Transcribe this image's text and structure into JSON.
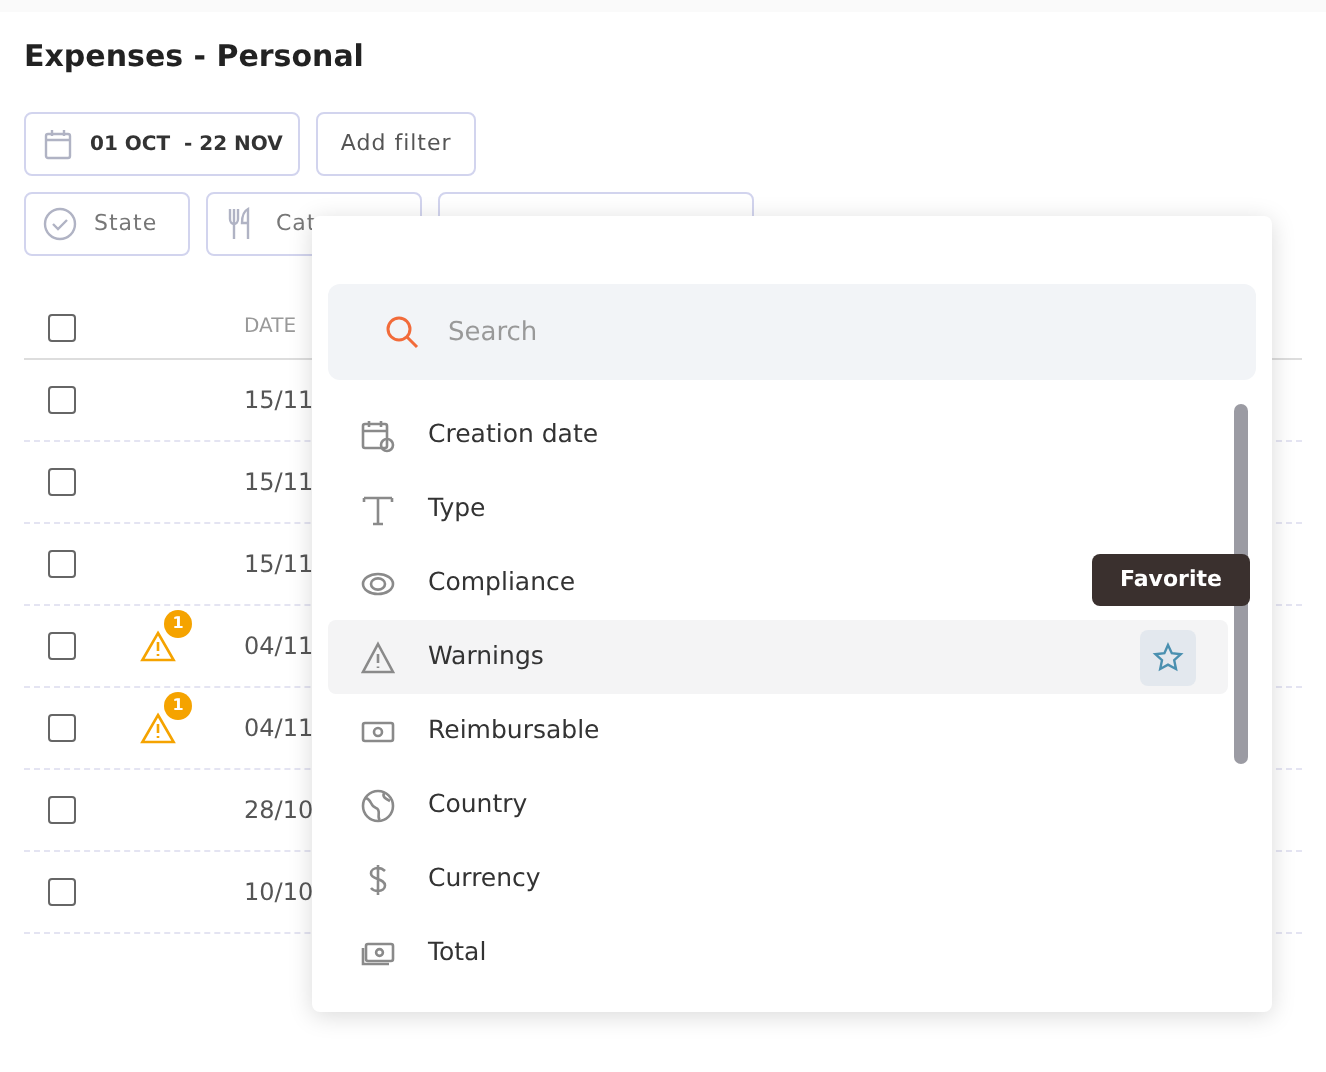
{
  "title": "Expenses - Personal",
  "date_filter": {
    "label": "01 OCT  - 22 NOV"
  },
  "add_filter": {
    "label": "Add filter"
  },
  "chips": [
    {
      "kind": "state",
      "label": "State"
    },
    {
      "kind": "category",
      "label": "Cat"
    },
    {
      "kind": "blank"
    }
  ],
  "table": {
    "select_all": {
      "checked": false
    },
    "columns": [
      "DATE"
    ],
    "rows": [
      {
        "checked": false,
        "date": "15/11"
      },
      {
        "checked": false,
        "date": "15/11"
      },
      {
        "checked": false,
        "date": "15/11"
      },
      {
        "checked": false,
        "date": "04/11",
        "warning_count": "1"
      },
      {
        "checked": false,
        "date": "04/11",
        "warning_count": "1"
      },
      {
        "checked": false,
        "date": "28/10"
      },
      {
        "checked": false,
        "date": "10/10"
      }
    ]
  },
  "dropdown": {
    "search": {
      "placeholder": "Search"
    },
    "items": [
      {
        "kind": "calendar",
        "label": "Creation date",
        "hovered": false
      },
      {
        "kind": "type",
        "label": "Type",
        "hovered": false
      },
      {
        "kind": "eye",
        "label": "Compliance",
        "hovered": false
      },
      {
        "kind": "warning",
        "label": "Warnings",
        "hovered": true
      },
      {
        "kind": "cash",
        "label": "Reimbursable",
        "hovered": false
      },
      {
        "kind": "globe",
        "label": "Country",
        "hovered": false
      },
      {
        "kind": "dollar",
        "label": "Currency",
        "hovered": false
      },
      {
        "kind": "total",
        "label": "Total",
        "hovered": false
      }
    ],
    "tooltip": "Favorite"
  }
}
